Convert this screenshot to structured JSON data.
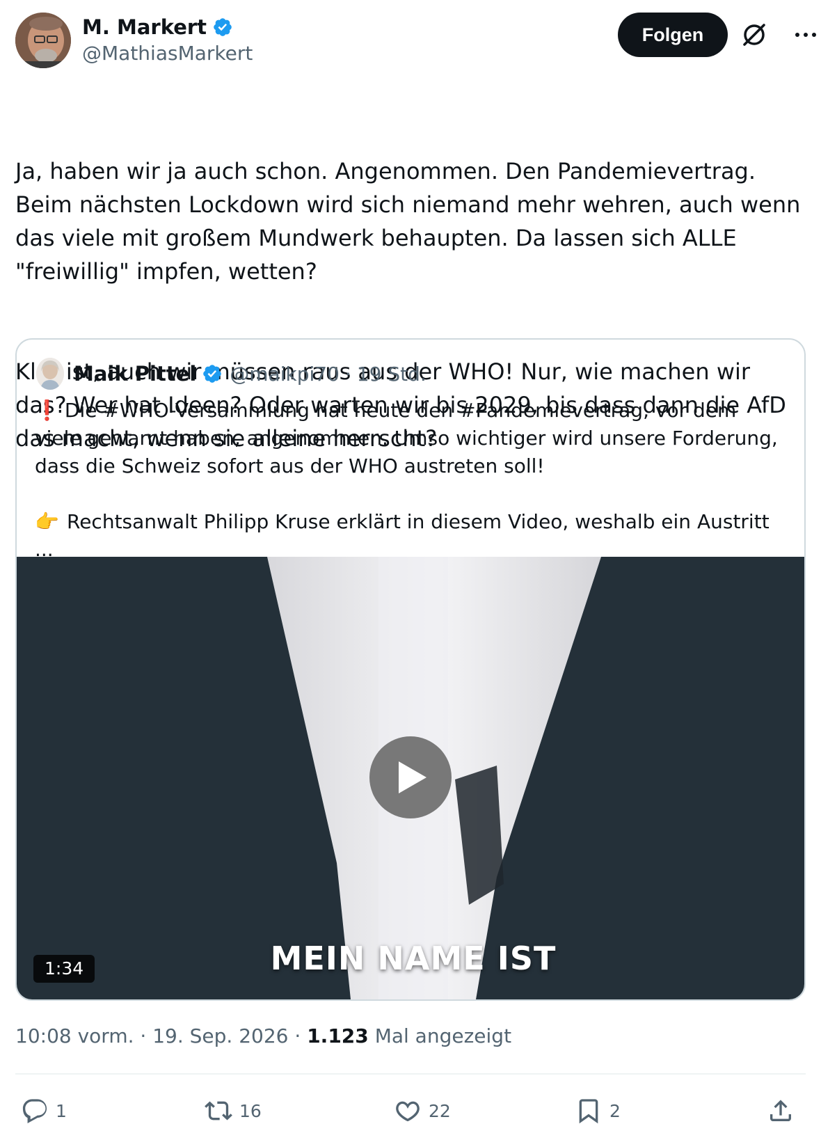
{
  "author": {
    "display_name": "M. Markert",
    "handle": "@MathiasMarkert",
    "verified": true
  },
  "header": {
    "follow_label": "Folgen",
    "icons": [
      "verified-badge-icon",
      "grok-icon",
      "more-icon"
    ]
  },
  "tweet": {
    "paragraphs": [
      "Ja, haben wir ja auch schon. Angenommen. Den Pandemievertrag. Beim nächsten Lockdown wird sich niemand mehr wehren, auch wenn das viele mit großem Mundwerk behaupten. Da lassen sich ALLE \"freiwillig\" impfen, wetten?",
      "Klar ist, auch wir müssen raus aus der WHO! Nur, wie machen wir das? Wer hat Ideen? Oder warten wir bis 2029, bis dass dann die AfD das macht, wenn sie alleine herrscht?"
    ]
  },
  "quote": {
    "display_name": "Maik Pittel",
    "handle": "@maikpi70",
    "separator": "·",
    "time": "19 Std.",
    "line1_emoji": "❗",
    "line1": "Die #WHO-Versammlung hat heute den #Pandemievertrag, vor dem viele gewarnt haben, angenommen. Umso wichtiger wird unsere Forderung, dass die Schweiz sofort aus der WHO austreten soll!",
    "line2_emoji": "👉",
    "line2": "Rechtsanwalt Philipp Kruse erklärt in diesem Video, weshalb ein Austritt ...",
    "video": {
      "duration": "1:34",
      "caption": "MEIN NAME IST"
    }
  },
  "meta": {
    "time": "10:08 vorm.",
    "sep1": "·",
    "date": "19. Sep. 2026",
    "sep2": "·",
    "views": "1.123",
    "views_label": "Mal angezeigt"
  },
  "actions": {
    "replies": "1",
    "reposts": "16",
    "likes": "22",
    "bookmarks": "2"
  },
  "colors": {
    "text": "#0f1419",
    "muted": "#536471",
    "verified": "#1d9bf0",
    "border": "#cfd9de",
    "follow_bg": "#0f1419"
  }
}
